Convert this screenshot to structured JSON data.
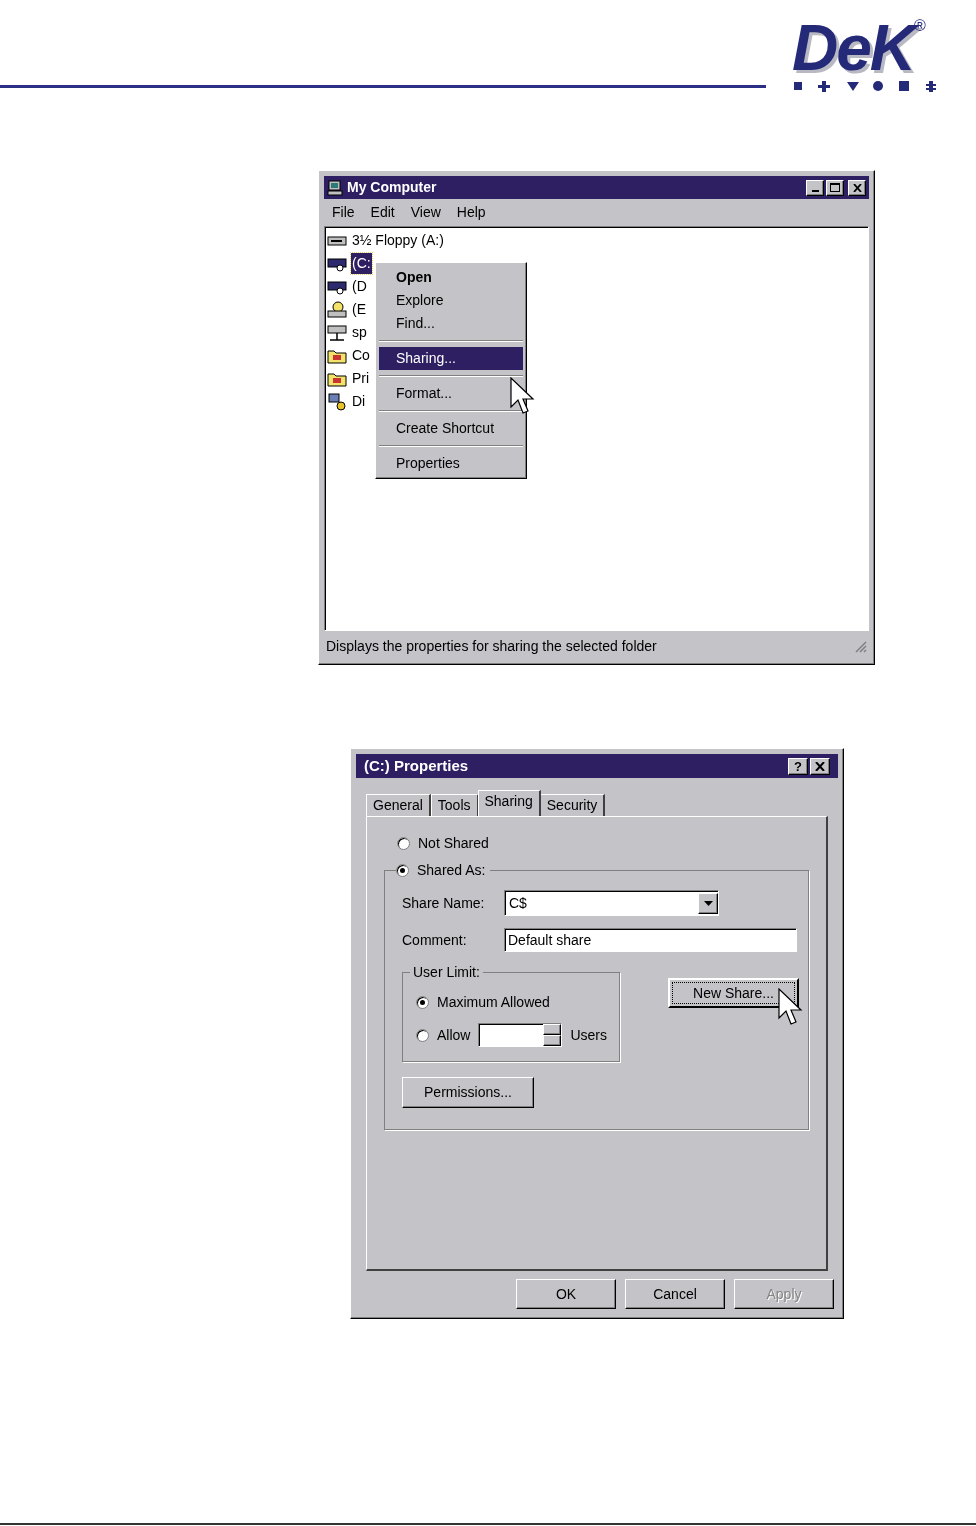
{
  "logo": {
    "text": "DeK",
    "registered": "®"
  },
  "explorer": {
    "title": "My Computer",
    "menu": [
      "File",
      "Edit",
      "View",
      "Help"
    ],
    "items": [
      {
        "kind": "floppy",
        "label": "3½ Floppy (A:)",
        "selected": false
      },
      {
        "kind": "drive",
        "label": "(C:",
        "selected": true
      },
      {
        "kind": "drive",
        "label": "(D",
        "selected": false
      },
      {
        "kind": "cdrom",
        "label": "(E",
        "selected": false
      },
      {
        "kind": "netdrive",
        "label": "sp",
        "selected": false
      },
      {
        "kind": "folder",
        "label": "Co",
        "selected": false
      },
      {
        "kind": "folder",
        "label": "Pri",
        "selected": false
      },
      {
        "kind": "network",
        "label": "Di",
        "selected": false
      }
    ],
    "context_menu": [
      {
        "kind": "item",
        "label": "Open",
        "default": true,
        "selected": false
      },
      {
        "kind": "item",
        "label": "Explore",
        "default": false,
        "selected": false
      },
      {
        "kind": "item",
        "label": "Find...",
        "default": false,
        "selected": false
      },
      {
        "kind": "separator"
      },
      {
        "kind": "item",
        "label": "Sharing...",
        "default": false,
        "selected": true
      },
      {
        "kind": "separator"
      },
      {
        "kind": "item",
        "label": "Format...",
        "default": false,
        "selected": false
      },
      {
        "kind": "separator"
      },
      {
        "kind": "item",
        "label": "Create Shortcut",
        "default": false,
        "selected": false
      },
      {
        "kind": "separator"
      },
      {
        "kind": "item",
        "label": "Properties",
        "default": false,
        "selected": false
      }
    ],
    "status_bar": "Displays the properties for sharing the selected folder"
  },
  "dialog": {
    "title": "(C:) Properties",
    "title_buttons": [
      "?"
    ],
    "tabs": [
      {
        "label": "General",
        "selected": false
      },
      {
        "label": "Tools",
        "selected": false
      },
      {
        "label": "Sharing",
        "selected": true
      },
      {
        "label": "Security",
        "selected": false
      }
    ],
    "not_shared": {
      "label": "Not Shared",
      "selected": false
    },
    "shared_as": {
      "label": "Shared As:",
      "selected": true
    },
    "share_name": {
      "label": "Share Name:",
      "value": "C$"
    },
    "comment": {
      "label": "Comment:",
      "value": "Default share"
    },
    "user_limit": {
      "title": "User Limit:",
      "options": [
        {
          "label": "Maximum Allowed",
          "selected": true
        },
        {
          "label": "Allow",
          "selected": false
        }
      ],
      "unit": "Users"
    },
    "new_share_button": "New Share...",
    "permissions_button": "Permissions...",
    "buttons": [
      {
        "label": "OK",
        "disabled": false
      },
      {
        "label": "Cancel",
        "disabled": false
      },
      {
        "label": "Apply",
        "disabled": true
      }
    ]
  }
}
